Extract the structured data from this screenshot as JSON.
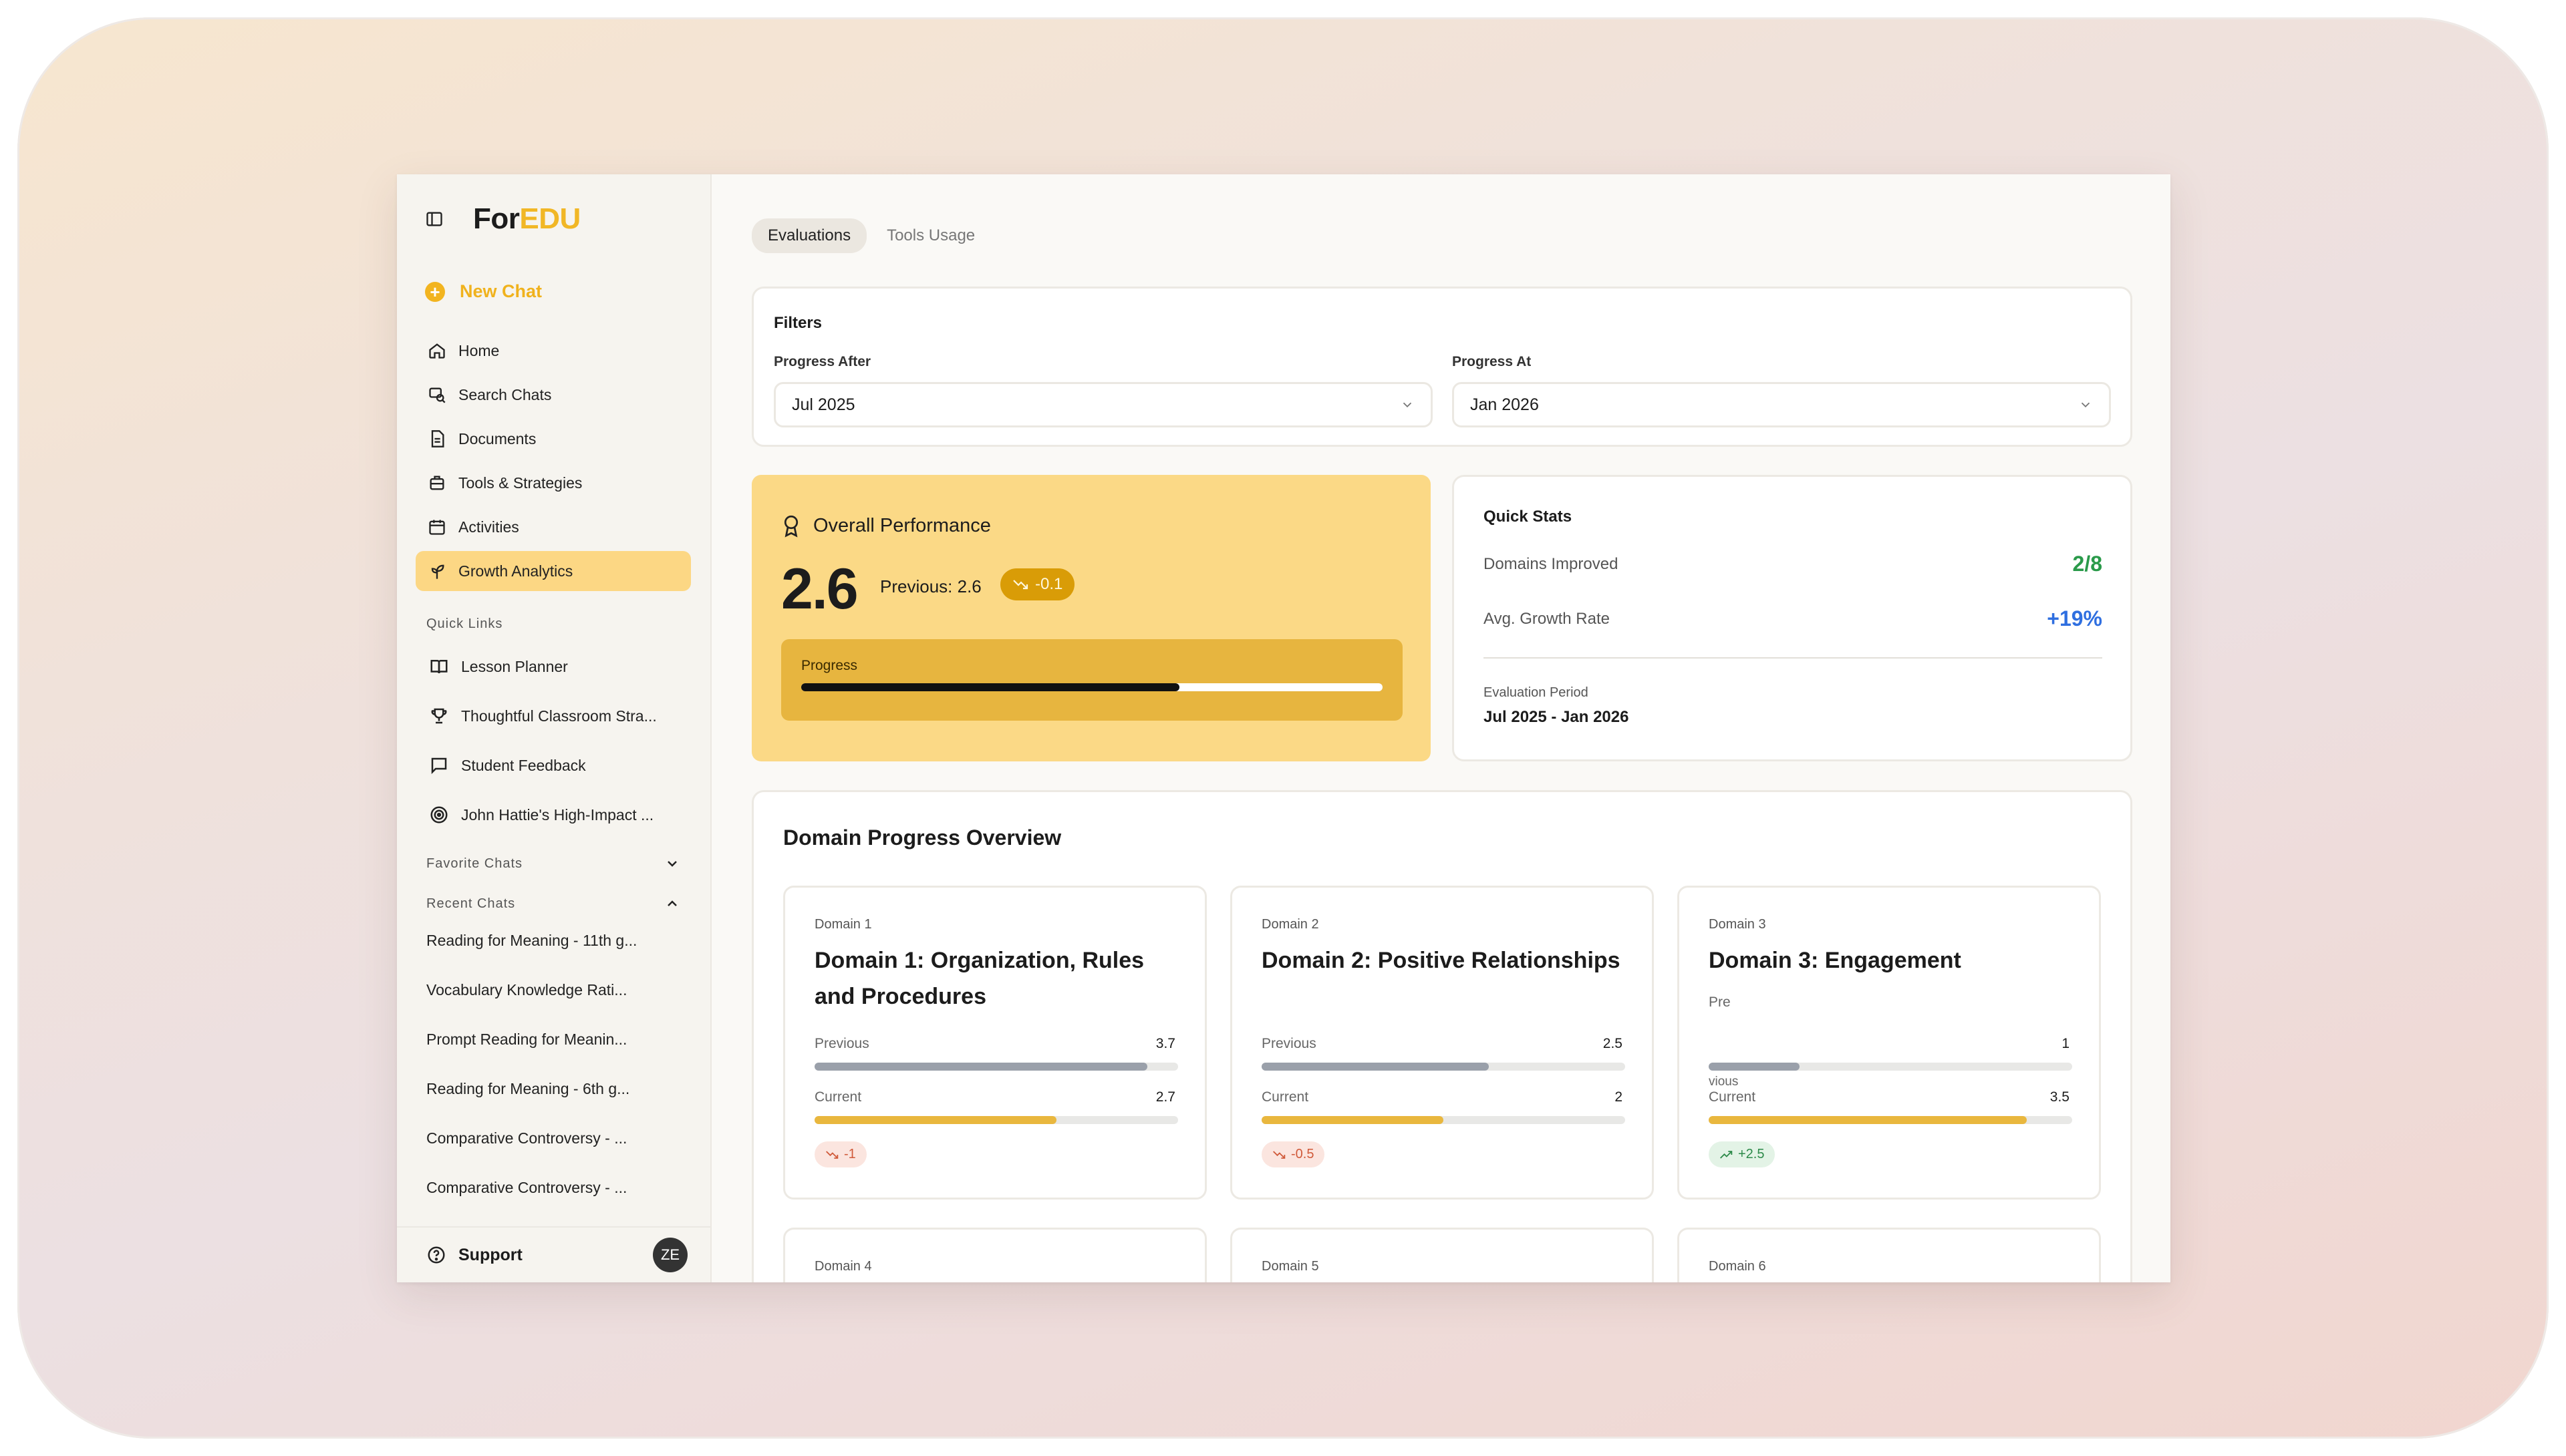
{
  "brand": {
    "prefix": "For",
    "accent": "EDU"
  },
  "sidebar": {
    "new_chat": "New Chat",
    "nav": [
      {
        "label": "Home",
        "icon": "home-icon"
      },
      {
        "label": "Search Chats",
        "icon": "search-chats-icon"
      },
      {
        "label": "Documents",
        "icon": "document-icon"
      },
      {
        "label": "Tools & Strategies",
        "icon": "tools-icon"
      },
      {
        "label": "Activities",
        "icon": "calendar-icon"
      },
      {
        "label": "Growth Analytics",
        "icon": "growth-icon",
        "active": true
      }
    ],
    "quick_links_label": "Quick Links",
    "quick_links": [
      {
        "label": "Lesson Planner",
        "icon": "book-icon"
      },
      {
        "label": "Thoughtful Classroom Stra...",
        "icon": "trophy-icon"
      },
      {
        "label": "Student Feedback",
        "icon": "chat-bubble-icon"
      },
      {
        "label": "John Hattie's High-Impact ...",
        "icon": "target-icon"
      }
    ],
    "favorite_chats_label": "Favorite Chats",
    "recent_chats_label": "Recent Chats",
    "recent_chats": [
      "Reading for Meaning - 11th g...",
      "Vocabulary Knowledge Rati...",
      "Prompt Reading for Meanin...",
      "Reading for Meaning - 6th g...",
      "Comparative Controversy - ...",
      "Comparative Controversy - ..."
    ],
    "support_label": "Support",
    "avatar_initials": "ZE"
  },
  "tabs": [
    {
      "label": "Evaluations",
      "active": true
    },
    {
      "label": "Tools Usage",
      "active": false
    }
  ],
  "filters": {
    "title": "Filters",
    "progress_after_label": "Progress After",
    "progress_after_value": "Jul 2025",
    "progress_at_label": "Progress At",
    "progress_at_value": "Jan 2026"
  },
  "overall": {
    "title": "Overall Performance",
    "score": "2.6",
    "previous": "Previous: 2.6",
    "delta": "-0.1",
    "progress_label": "Progress",
    "progress_fraction": 0.65
  },
  "quick_stats": {
    "title": "Quick Stats",
    "domains_improved_label": "Domains Improved",
    "domains_improved_value": "2/8",
    "avg_growth_label": "Avg. Growth Rate",
    "avg_growth_value": "+19%",
    "period_label": "Evaluation Period",
    "period_value": "Jul 2025 - Jan 2026"
  },
  "domain_overview": {
    "title": "Domain Progress Overview",
    "cards": [
      {
        "tag": "Domain 1",
        "title": "Domain 1: Organization, Rules and Procedures",
        "previous_label": "Previous",
        "previous": "3.7",
        "previous_fraction": 0.915,
        "current_label": "Current",
        "current": "2.7",
        "current_fraction": 0.665,
        "delta": "-1",
        "trend": "down"
      },
      {
        "tag": "Domain 2",
        "title": "Domain 2: Positive Relationships",
        "previous_label": "Previous",
        "previous": "2.5",
        "previous_fraction": 0.625,
        "current_label": "Current",
        "current": "2",
        "current_fraction": 0.5,
        "delta": "-0.5",
        "trend": "down"
      },
      {
        "tag": "Domain 3",
        "title": "Domain 3: Engagement",
        "pre_text": "Pre",
        "previous_label": "vious",
        "previous": "1",
        "previous_fraction": 0.25,
        "current_label": "Current",
        "current": "3.5",
        "current_fraction": 0.875,
        "delta": "+2.5",
        "trend": "up"
      }
    ],
    "stubs": [
      "Domain 4",
      "Domain 5",
      "Domain 6"
    ]
  },
  "colors": {
    "accent": "#f1b726",
    "stat_green": "#2a9a4a",
    "stat_blue": "#2f6fe0"
  }
}
